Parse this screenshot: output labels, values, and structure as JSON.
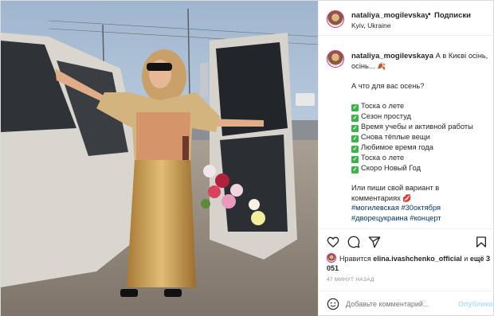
{
  "post": {
    "username": "nataliya_mogilevskaya",
    "separator": "•",
    "follow_label": "Подписки",
    "location": "Kyiv, Ukraine"
  },
  "caption": {
    "username": "nataliya_mogilevskaya",
    "first_line": "А в Києві осінь, осінь...",
    "leaf_emoji": "🍂",
    "question": "А что для вас осень?",
    "check_symbol": "✓",
    "items": [
      "Тоска о лете",
      "Сезон простуд",
      "Время учебы и активной работы",
      "Снова тёплые вещи",
      "Любимое время года",
      "Тоска о лете",
      "Скоро Новый Год"
    ],
    "closing": "Или пиши свой вариант в комментариях",
    "lips_emoji": "💋",
    "hashtags": [
      "#могилевская",
      "#30октября",
      "#дворецукраина",
      "#концерт"
    ]
  },
  "likes": {
    "prefix": "Нравится",
    "liker": "elina.ivashchenko_official",
    "middle": "и",
    "count_text": "ещё 3 051"
  },
  "timestamp": "47 МИНУТ НАЗАД",
  "comment": {
    "placeholder": "Добавьте комментарий...",
    "publish_label": "Опубликовать"
  },
  "icons": {
    "like": "heart-icon",
    "comment": "comment-icon",
    "share": "share-icon",
    "save": "bookmark-icon",
    "emoji": "smile-icon"
  }
}
